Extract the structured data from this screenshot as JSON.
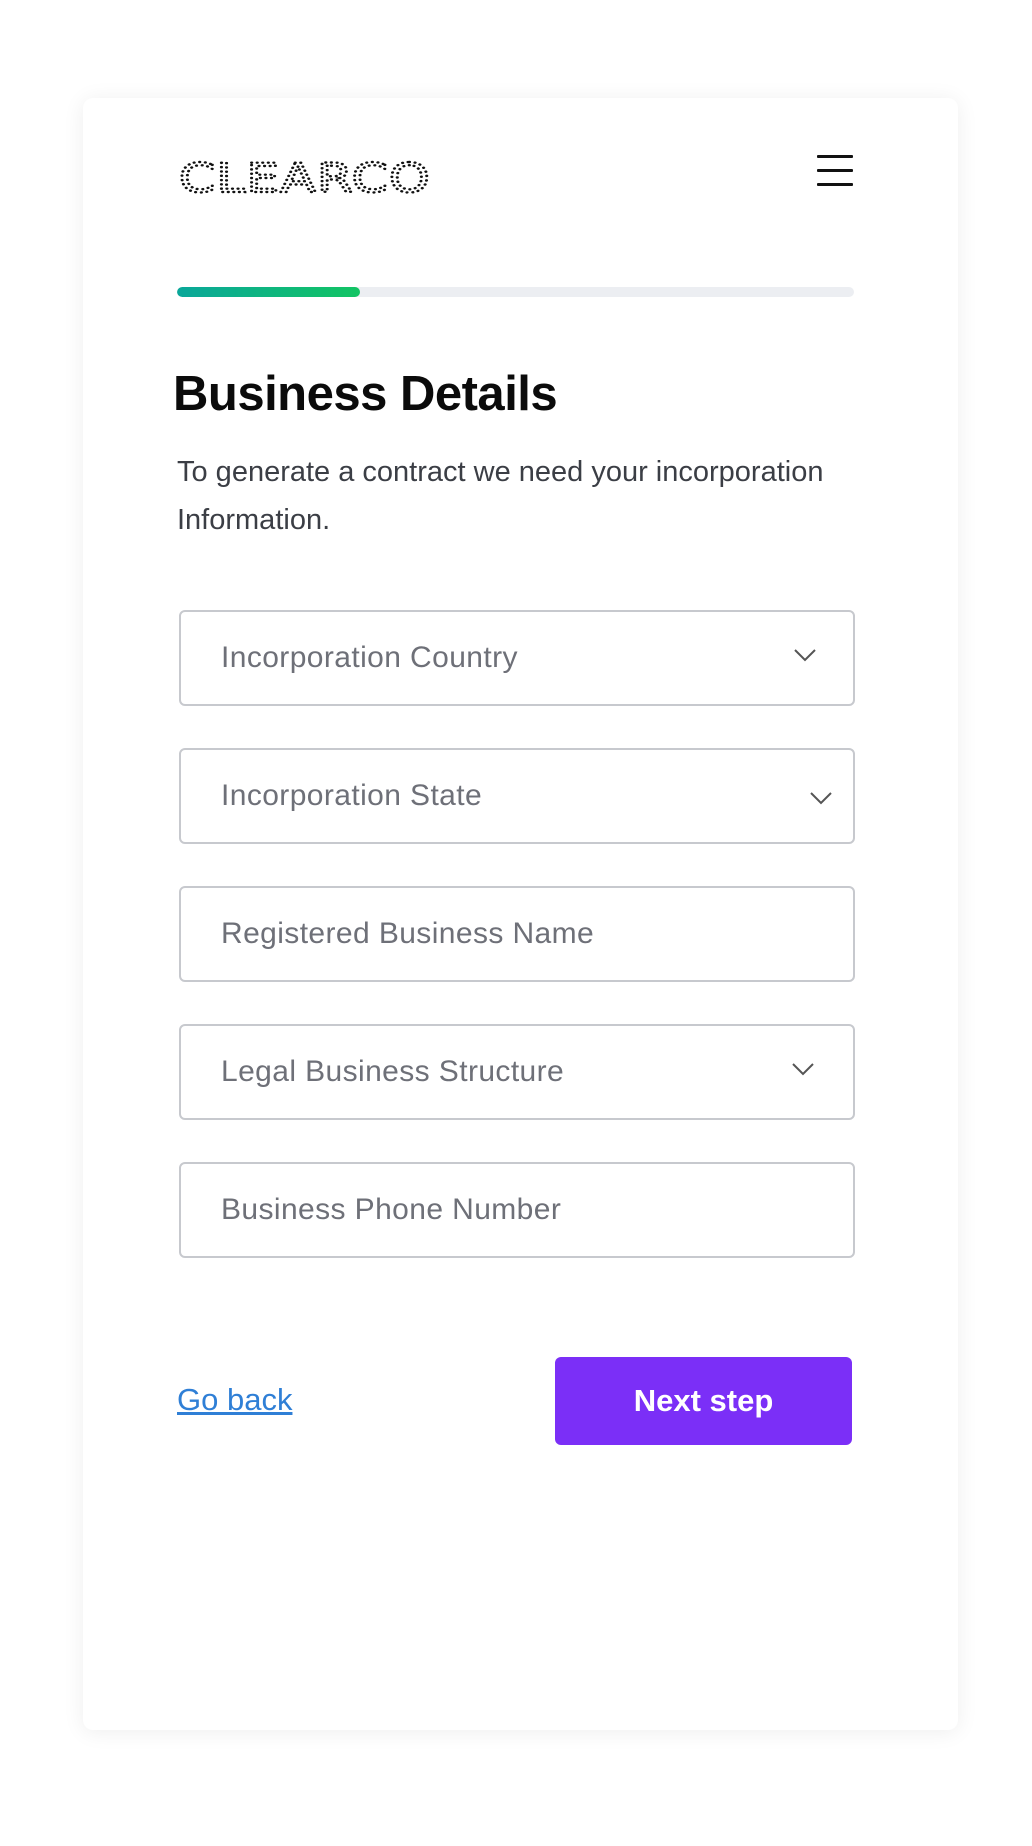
{
  "brand": {
    "logo_text": "CLEARCO"
  },
  "header": {
    "menu_icon": "hamburger-menu-icon"
  },
  "progress": {
    "value": 0.27,
    "accent_colors": [
      "#0aa79a",
      "#12c463"
    ]
  },
  "page": {
    "title": "Business Details",
    "subtitle": "To generate a contract we need your incorporation Information."
  },
  "form": {
    "incorporation_country": {
      "placeholder": "Incorporation Country",
      "type": "select",
      "icon": "chevron-down-icon"
    },
    "incorporation_state": {
      "placeholder": "Incorporation State",
      "type": "select",
      "icon": "chevron-down-icon"
    },
    "registered_business_name": {
      "placeholder": "Registered Business Name",
      "type": "text"
    },
    "legal_business_structure": {
      "placeholder": "Legal Business Structure",
      "type": "select",
      "icon": "chevron-down-icon"
    },
    "business_phone_number": {
      "placeholder": "Business Phone Number",
      "type": "text"
    }
  },
  "actions": {
    "go_back_label": "Go back",
    "next_step_label": "Next step",
    "primary_color": "#7b2ff7",
    "link_color": "#2f7fd6"
  }
}
